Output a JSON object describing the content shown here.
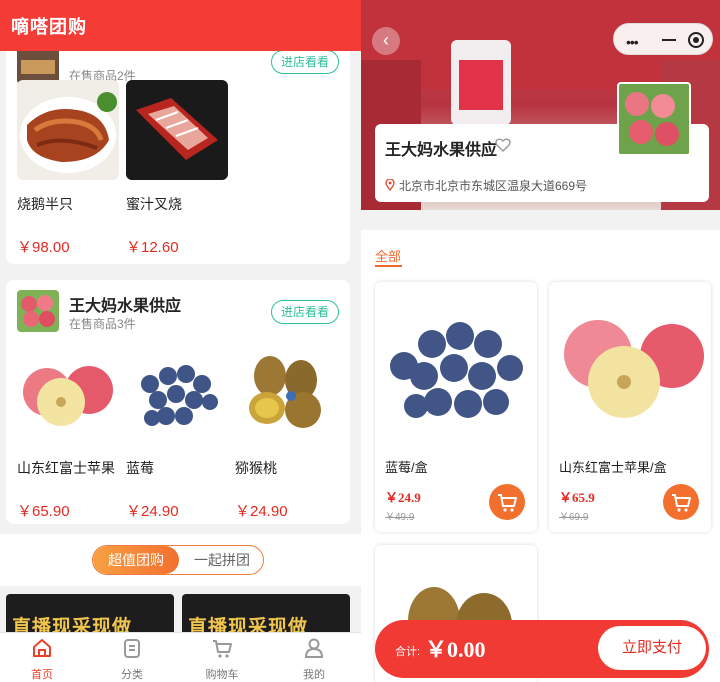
{
  "left": {
    "header_title": "嘀嗒团购",
    "store1": {
      "name": "",
      "count": "在售商品2件",
      "enter": "进店看看",
      "products": [
        {
          "name": "烧鹅半只",
          "price": "￥98.00"
        },
        {
          "name": "蜜汁叉烧",
          "price": "￥12.60"
        }
      ]
    },
    "store2": {
      "name": "王大妈水果供应",
      "count": "在售商品3件",
      "enter": "进店看看",
      "products": [
        {
          "name": "山东红富士苹果",
          "price": "￥65.90"
        },
        {
          "name": "蓝莓",
          "price": "￥24.90"
        },
        {
          "name": "猕猴桃",
          "price": "￥24.90"
        }
      ]
    },
    "tabs": [
      "超值团购",
      "一起拼团"
    ],
    "banner_text": "直播现采现做",
    "tabbar": [
      {
        "label": "首页",
        "icon": "home-icon"
      },
      {
        "label": "分类",
        "icon": "category-icon"
      },
      {
        "label": "购物车",
        "icon": "cart-icon"
      },
      {
        "label": "我的",
        "icon": "user-icon"
      }
    ]
  },
  "right": {
    "store_name": "王大妈水果供应",
    "address": "北京市北京市东城区温泉大道669号",
    "filter_tab": "全部",
    "products": [
      {
        "name": "蓝莓/盒",
        "price": "￥24.9",
        "original": "￥49.9"
      },
      {
        "name": "山东红富士苹果/盒",
        "price": "￥65.9",
        "original": "￥69.9"
      }
    ],
    "total_label": "合计:",
    "total_amount": "￥0.00",
    "pay_button": "立即支付"
  },
  "colors": {
    "brand_red": "#f43b35",
    "price_red": "#e52a22",
    "accent_orange": "#f26f2e",
    "store_green": "#2fbf9b"
  }
}
